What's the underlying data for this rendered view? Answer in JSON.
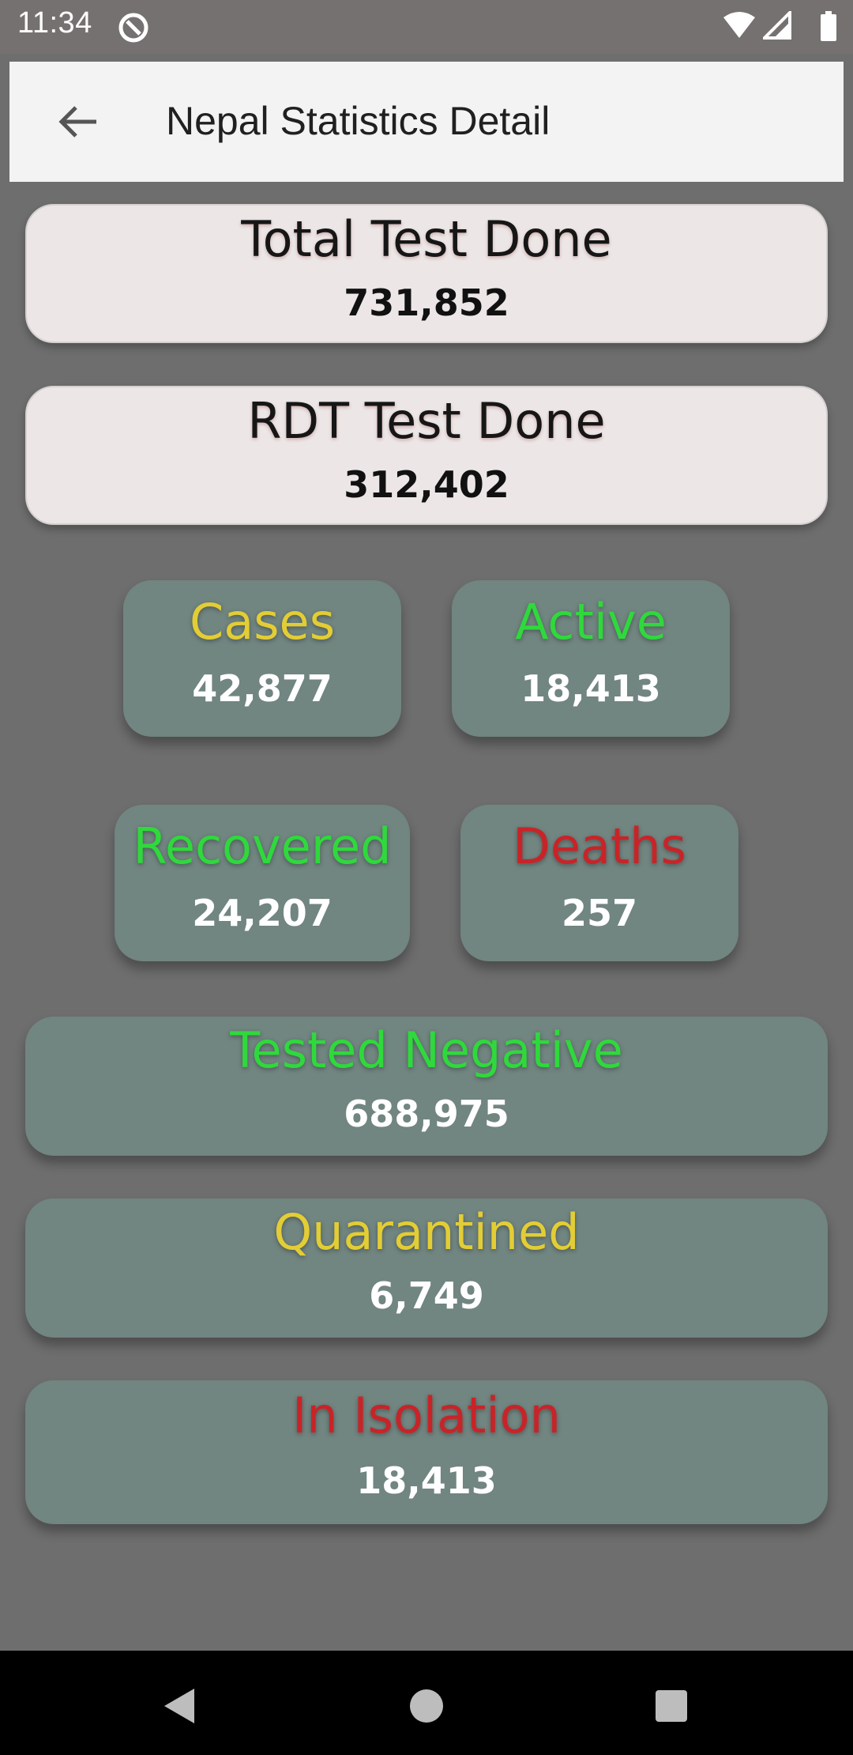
{
  "status_bar": {
    "time": "11:34",
    "icons": [
      "app-notification-icon",
      "wifi-icon",
      "signal-icon",
      "battery-icon"
    ]
  },
  "app_bar": {
    "title": "Nepal Statistics Detail",
    "back_icon": "arrow-back-icon"
  },
  "colors": {
    "yellow": "#e3cd35",
    "green": "#2fd93c",
    "red": "#c82428",
    "card_dark": "#718581",
    "card_light": "#ece6e6"
  },
  "stats": {
    "total_test": {
      "label": "Total Test Done",
      "value": "731,852"
    },
    "rdt_test": {
      "label": "RDT Test Done",
      "value": "312,402"
    },
    "cases": {
      "label": "Cases",
      "value": "42,877"
    },
    "active": {
      "label": "Active",
      "value": "18,413"
    },
    "recovered": {
      "label": "Recovered",
      "value": "24,207"
    },
    "deaths": {
      "label": "Deaths",
      "value": "257"
    },
    "tested_negative": {
      "label": "Tested Negative",
      "value": "688,975"
    },
    "quarantined": {
      "label": "Quarantined",
      "value": "6,749"
    },
    "in_isolation": {
      "label": "In Isolation",
      "value": "18,413"
    }
  },
  "nav_bar": {
    "buttons": [
      "nav-back-icon",
      "nav-home-icon",
      "nav-recents-icon"
    ]
  }
}
